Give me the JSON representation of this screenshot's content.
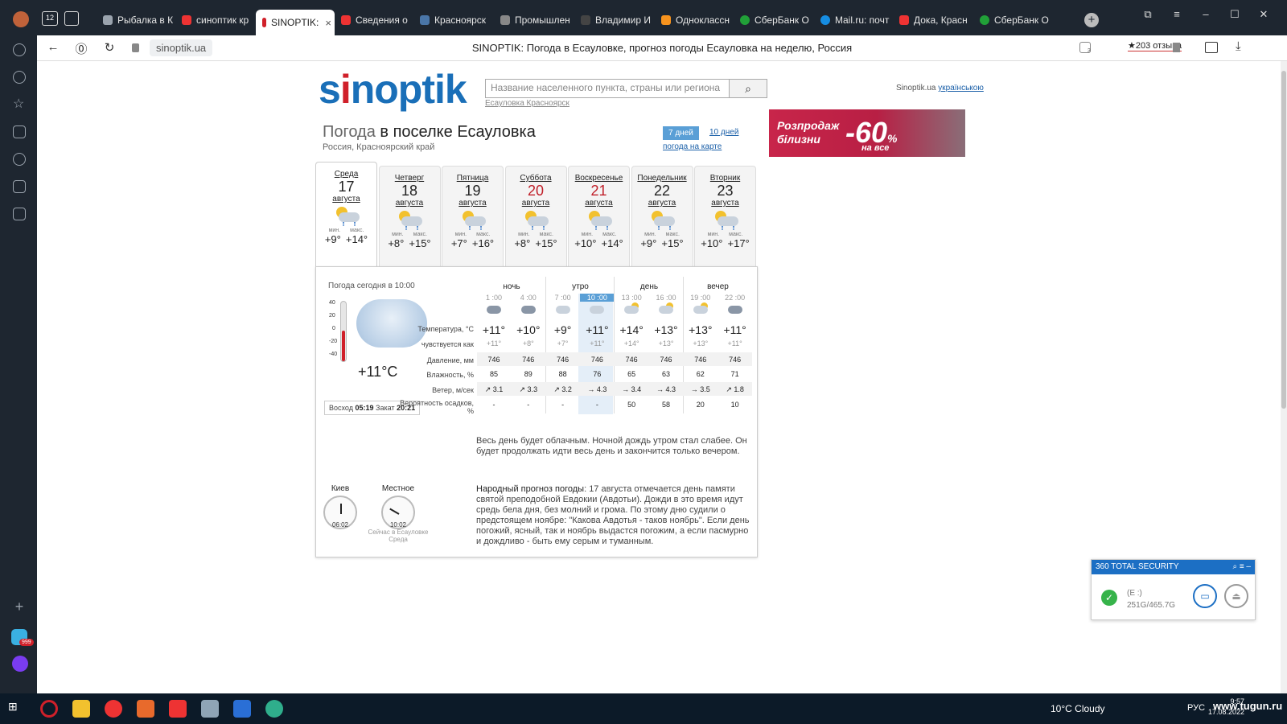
{
  "browser": {
    "tabs": [
      {
        "label": "Рыбалка в К",
        "color": "#9aa3ad"
      },
      {
        "label": "синоптик кр",
        "color": "#e33"
      },
      {
        "label": "SINOPTIK:",
        "color": "#d0202a",
        "active": true
      },
      {
        "label": "Сведения о",
        "color": "#e33"
      },
      {
        "label": "Красноярск",
        "color": "#4a76a8"
      },
      {
        "label": "Промышлен",
        "color": "#888"
      },
      {
        "label": "Владимир И",
        "color": "#444"
      },
      {
        "label": "Одноклассн",
        "color": "#f7931e"
      },
      {
        "label": "СберБанк О",
        "color": "#21a038"
      },
      {
        "label": "Mail.ru: почт",
        "color": "#168de2"
      },
      {
        "label": "Дока, Красн",
        "color": "#e33"
      },
      {
        "label": "СберБанк О",
        "color": "#21a038"
      }
    ],
    "tab_close": "×",
    "tab_count": "12",
    "url": "sinoptik.ua",
    "page_title": "SINOPTIK: Погода в Есауловке, прогноз погоды Есауловка на неделю, Россия",
    "reviews": "★203 отзыва",
    "ext_badge": "3"
  },
  "header": {
    "logo_pre": "s",
    "logo_i": "i",
    "logo_post": "noptik",
    "search_placeholder": "Название населенного пункта, страны или региона",
    "search_icon": "search-icon",
    "recent": "Есауловка Красноярск",
    "lang_prefix": "Sinoptik.ua",
    "lang_link": "українською"
  },
  "title": {
    "prefix": "Погода",
    "main": "в поселке Есауловка",
    "region": "Россия, Красноярский край",
    "btn7": "7 дней",
    "btn10": "10 дней",
    "map": "погода на карте"
  },
  "ad": {
    "line1": "Розпродаж",
    "line2": "білизни",
    "percent": "-60",
    "pct_sign": "%",
    "footer": "на все"
  },
  "days": [
    {
      "name": "Среда",
      "date": "17",
      "month": "августа",
      "min": "+9°",
      "max": "+14°",
      "weekend": false
    },
    {
      "name": "Четверг",
      "date": "18",
      "month": "августа",
      "min": "+8°",
      "max": "+15°",
      "weekend": false
    },
    {
      "name": "Пятница",
      "date": "19",
      "month": "августа",
      "min": "+7°",
      "max": "+16°",
      "weekend": false
    },
    {
      "name": "Суббота",
      "date": "20",
      "month": "августа",
      "min": "+8°",
      "max": "+15°",
      "weekend": true
    },
    {
      "name": "Воскресенье",
      "date": "21",
      "month": "августа",
      "min": "+10°",
      "max": "+14°",
      "weekend": true
    },
    {
      "name": "Понедельник",
      "date": "22",
      "month": "августа",
      "min": "+9°",
      "max": "+15°",
      "weekend": false
    },
    {
      "name": "Вторник",
      "date": "23",
      "month": "августа",
      "min": "+10°",
      "max": "+17°",
      "weekend": false
    }
  ],
  "day_labels": {
    "min": "мин.",
    "max": "макс."
  },
  "today": {
    "label": "Погода сегодня в 10:00",
    "temp": "+11°C",
    "scale": [
      "40",
      "20",
      "0",
      "-20",
      "-40"
    ],
    "sunrise_label": "Восход",
    "sunrise": "05:19",
    "sunset_label": "Закат",
    "sunset": "20:21"
  },
  "periods": [
    "ночь",
    "утро",
    "день",
    "вечер"
  ],
  "hours": [
    "1 :00",
    "4 :00",
    "7 :00",
    "10 :00",
    "13 :00",
    "16 :00",
    "19 :00",
    "22 :00"
  ],
  "row_labels": {
    "temp": "Температура, °C",
    "feels": "чувствуется как",
    "pressure": "Давление, мм",
    "humidity": "Влажность, %",
    "wind": "Ветер, м/сек",
    "precip": "Вероятность осадков, %"
  },
  "temps": [
    "+11°",
    "+10°",
    "+9°",
    "+11°",
    "+14°",
    "+13°",
    "+13°",
    "+11°"
  ],
  "feels": [
    "+11°",
    "+8°",
    "+7°",
    "+11°",
    "+14°",
    "+13°",
    "+13°",
    "+11°"
  ],
  "pressure": [
    "746",
    "746",
    "746",
    "746",
    "746",
    "746",
    "746",
    "746"
  ],
  "humidity": [
    "85",
    "89",
    "88",
    "76",
    "65",
    "63",
    "62",
    "71"
  ],
  "wind": [
    "↗ 3.1",
    "↗ 3.3",
    "↗ 3.2",
    "→ 4.3",
    "→ 3.4",
    "→ 4.3",
    "→ 3.5",
    "↗ 1.8"
  ],
  "precip": [
    "-",
    "-",
    "-",
    "-",
    "50",
    "58",
    "20",
    "10"
  ],
  "description": "Весь день будет облачным. Ночной дождь утром стал слабее. Он будет продолжать идти весь день и закончится только вечером.",
  "folk_title": "Народный прогноз погоды",
  "folk_text": ": 17 августа отмечается день памяти святой преподобной Евдокии (Авдотьи). Дожди в это время идут средь бела дня, без молний и грома. По этому дню судили о предстоящем ноябре: \"Какова Авдотья - таков ноябрь\". Если день погожий, ясный, так и ноябрь выдастся погожим, а если пасмурно и дождливо - быть ему серым и туманным.",
  "clocks": {
    "kiev_label": "Киев",
    "kiev_time": "06:02",
    "local_label": "Местное",
    "local_time": "10:02",
    "local_sub1": "Сейчас в Есауловке",
    "local_sub2": "Среда"
  },
  "security": {
    "title": "360 TOTAL SECURITY",
    "drive": "(E :)",
    "size": "251G/465.7G"
  },
  "taskbar": {
    "weather": "10°C  Cloudy",
    "lang": "РУС",
    "time": "9:57",
    "date": "17.08.2022",
    "watermark": "www.tugun.ru",
    "badge": "999"
  }
}
